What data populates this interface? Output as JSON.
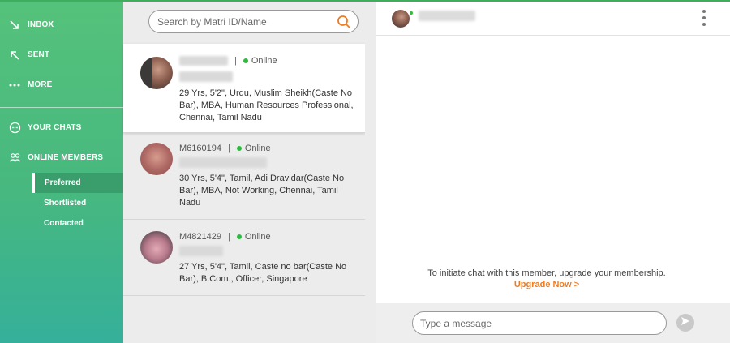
{
  "sidebar": {
    "inbox_label": "INBOX",
    "sent_label": "SENT",
    "more_label": "MORE",
    "your_chats_label": "YOUR CHATS",
    "online_members_label": "ONLINE MEMBERS",
    "sub_items": [
      "Preferred",
      "Shortlisted",
      "Contacted"
    ],
    "active_sub_item": "Preferred"
  },
  "search": {
    "placeholder": "Search by Matri ID/Name"
  },
  "members": [
    {
      "id": "",
      "status": "Online",
      "description": "29 Yrs,  5'2\", Urdu,  Muslim Sheikh(Caste No Bar),  MBA, Human Resources Professional,  Chennai,  Tamil Nadu"
    },
    {
      "id": "M6160194",
      "status": "Online",
      "description": "30 Yrs,  5'4\", Tamil,  Adi Dravidar(Caste No Bar),  MBA, Not Working,  Chennai,  Tamil Nadu"
    },
    {
      "id": "M4821429",
      "status": "Online",
      "description": "27 Yrs,  5'4\", Tamil,  Caste no bar(Caste No Bar),  B.Com., Officer,  Singapore"
    }
  ],
  "chat": {
    "upgrade_text": "To initiate chat with this member, upgrade your membership.",
    "upgrade_link": "Upgrade Now >",
    "message_placeholder": "Type a message"
  },
  "colors": {
    "accent": "#4cbb7a",
    "link": "#f07c22",
    "online": "#2dbb3d"
  },
  "icons": [
    "inbox-arrow-icon",
    "sent-arrow-icon",
    "more-dots-icon",
    "chat-bubble-icon",
    "online-members-icon",
    "search-icon",
    "kebab-menu-icon",
    "send-icon"
  ]
}
